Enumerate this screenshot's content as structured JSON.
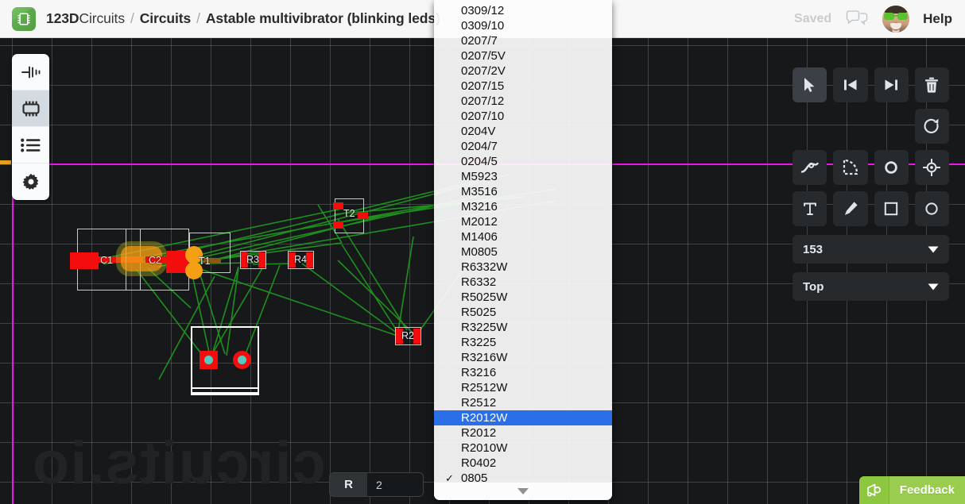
{
  "header": {
    "logo_icon": "chip-icon",
    "breadcrumb": {
      "brand_bold": "123D",
      "brand_light": "Circuits",
      "sep": "/",
      "section": "Circuits",
      "project": "Astable multivibrator (blinking leds)"
    },
    "saved_status": "Saved",
    "chat_icon": "chat-bubbles-icon",
    "avatar_alt": "user-avatar",
    "help_label": "Help"
  },
  "left_toolbar": {
    "items": [
      {
        "icon": "schematic-capacitor-icon",
        "label": "Schematic",
        "active": false
      },
      {
        "icon": "chip-pcb-icon",
        "label": "PCB",
        "active": true
      },
      {
        "icon": "list-icon",
        "label": "Components list",
        "active": false
      },
      {
        "icon": "gear-icon",
        "label": "Settings",
        "active": false
      }
    ]
  },
  "right_toolbar": {
    "rows": [
      [
        {
          "icon": "cursor-select-icon",
          "label": "Select",
          "active": true
        },
        {
          "icon": "skip-back-icon",
          "label": "Previous",
          "active": false
        },
        {
          "icon": "skip-forward-icon",
          "label": "Next",
          "active": false
        },
        {
          "icon": "trash-icon",
          "label": "Delete",
          "active": false
        }
      ],
      [
        {
          "icon": "spacer",
          "label": "",
          "active": false
        },
        {
          "icon": "spacer",
          "label": "",
          "active": false
        },
        {
          "icon": "spacer",
          "label": "",
          "active": false
        },
        {
          "icon": "rotate-icon",
          "label": "Rotate",
          "active": false
        }
      ],
      [
        {
          "icon": "trace-wire-icon",
          "label": "Trace",
          "active": false
        },
        {
          "icon": "polygon-icon",
          "label": "Polygon",
          "active": false
        },
        {
          "icon": "via-circle-icon",
          "label": "Via",
          "active": false
        },
        {
          "icon": "target-crosshair-icon",
          "label": "Alignment target",
          "active": false
        }
      ],
      [
        {
          "icon": "text-tool-icon",
          "label": "Text",
          "active": false
        },
        {
          "icon": "pen-tool-icon",
          "label": "Pen",
          "active": false
        },
        {
          "icon": "square-icon",
          "label": "Rectangle",
          "active": false
        },
        {
          "icon": "circle-icon",
          "label": "Circle",
          "active": false
        }
      ]
    ],
    "selects": [
      {
        "name": "size-select",
        "value": "153",
        "caret": "chevron-down-icon"
      },
      {
        "name": "layer-select",
        "value": "Top",
        "caret": "chevron-down-icon"
      }
    ]
  },
  "property_bar": {
    "label": "R",
    "value": "2"
  },
  "dropdown": {
    "name": "package-footprint-dropdown",
    "selected_highlight": "R2012W",
    "checked_value": "0805",
    "check_glyph": "✓",
    "scroll_down_icon": "triangle-down-icon",
    "items": [
      "0309/12",
      "0309/10",
      "0207/7",
      "0207/5V",
      "0207/2V",
      "0207/15",
      "0207/12",
      "0207/10",
      "0204V",
      "0204/7",
      "0204/5",
      "M5923",
      "M3516",
      "M3216",
      "M2012",
      "M1406",
      "M0805",
      "R6332W",
      "R6332",
      "R5025W",
      "R5025",
      "R3225W",
      "R3225",
      "R3216W",
      "R3216",
      "R2512W",
      "R2512",
      "R2012W",
      "R2012",
      "R2010W",
      "R0402",
      "0805"
    ]
  },
  "canvas": {
    "watermark": "circuits.io",
    "board_outline_color": "#e819e8",
    "grid_color": "#b8701e",
    "pad_color": "#f40d0d",
    "airwire_color": "#1f9b1f",
    "drill_color": "#56c8bd",
    "components": [
      {
        "ref": "C1",
        "type": "capacitor"
      },
      {
        "ref": "C2",
        "type": "capacitor"
      },
      {
        "ref": "T1",
        "type": "transistor"
      },
      {
        "ref": "T2",
        "type": "transistor"
      },
      {
        "ref": "R3",
        "type": "resistor"
      },
      {
        "ref": "R4",
        "type": "resistor"
      },
      {
        "ref": "R2",
        "type": "resistor"
      }
    ]
  },
  "feedback": {
    "icon": "megaphone-icon",
    "label": "Feedback"
  }
}
